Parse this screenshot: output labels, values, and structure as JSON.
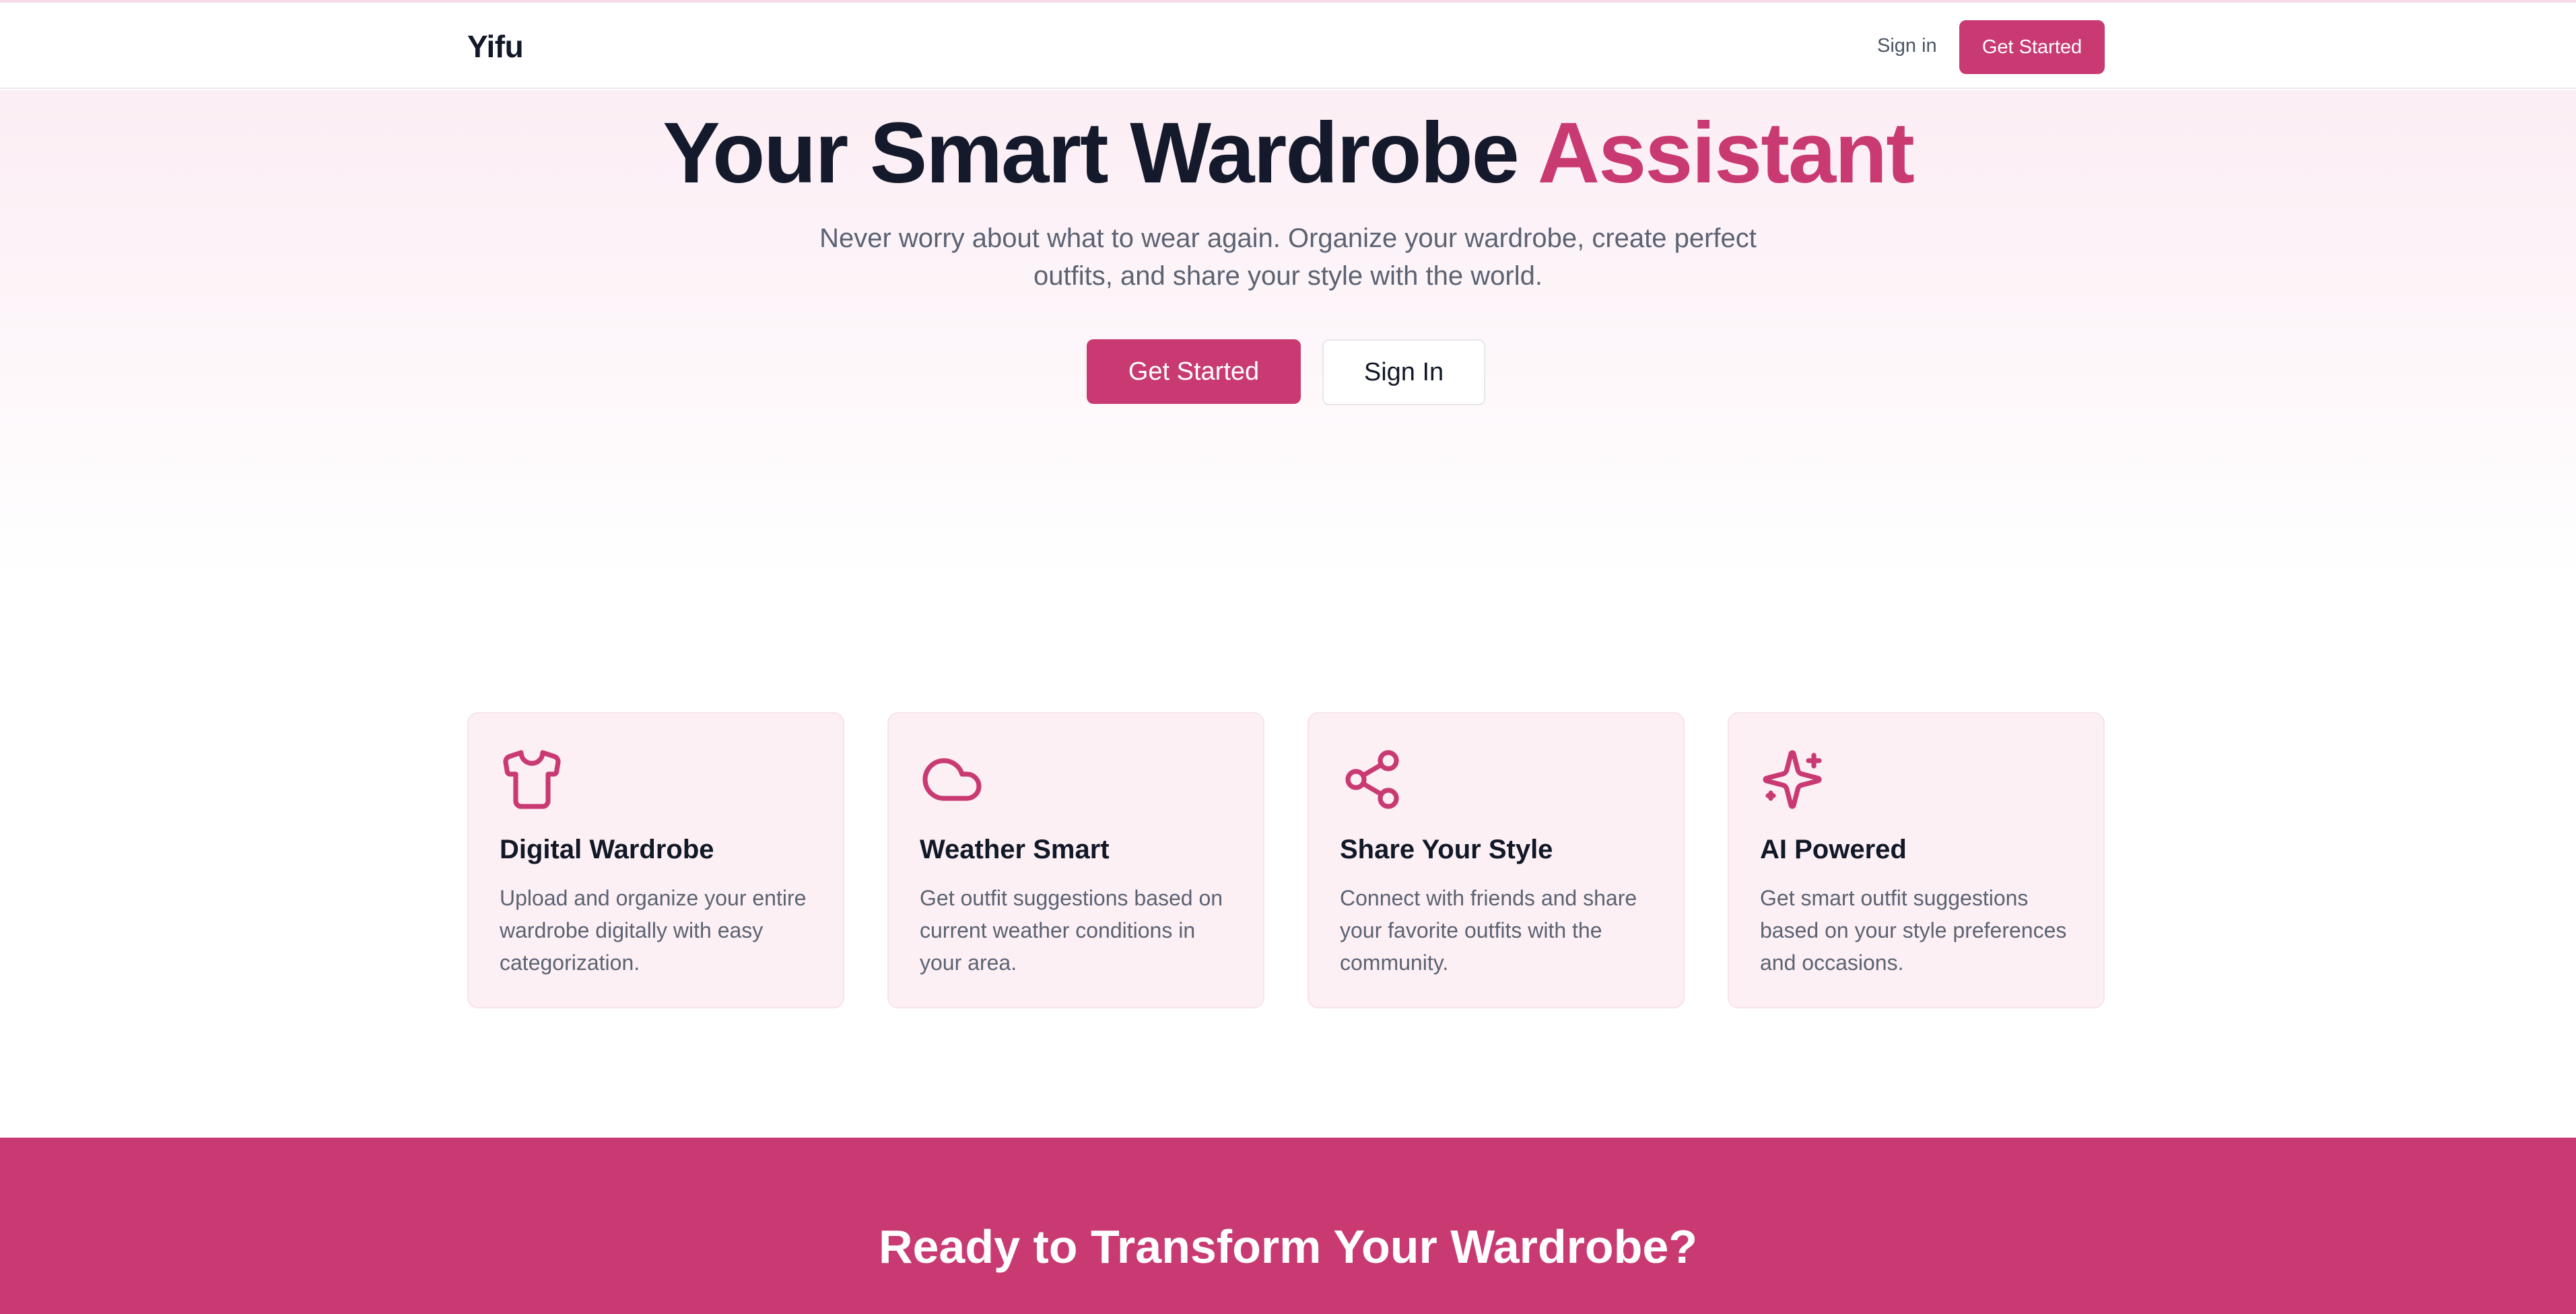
{
  "colors": {
    "brand": "#c93a73",
    "text_dark": "#111827",
    "text_muted": "#5b6272",
    "card_bg": "#fcf0f5"
  },
  "header": {
    "logo": "Yifu",
    "signin_label": "Sign in",
    "get_started_label": "Get Started"
  },
  "hero": {
    "title_main": "Your Smart Wardrobe ",
    "title_accent": "Assistant",
    "subtitle": "Never worry about what to wear again. Organize your wardrobe, create perfect outfits, and share your style with the world.",
    "primary_button": "Get Started",
    "secondary_button": "Sign In"
  },
  "features": [
    {
      "icon": "shirt-icon",
      "title": "Digital Wardrobe",
      "description": "Upload and organize your entire wardrobe digitally with easy categorization."
    },
    {
      "icon": "cloud-icon",
      "title": "Weather Smart",
      "description": "Get outfit suggestions based on current weather conditions in your area."
    },
    {
      "icon": "share-icon",
      "title": "Share Your Style",
      "description": "Connect with friends and share your favorite outfits with the community."
    },
    {
      "icon": "sparkles-icon",
      "title": "AI Powered",
      "description": "Get smart outfit suggestions based on your style preferences and occasions."
    }
  ],
  "cta": {
    "title": "Ready to Transform Your Wardrobe?"
  }
}
